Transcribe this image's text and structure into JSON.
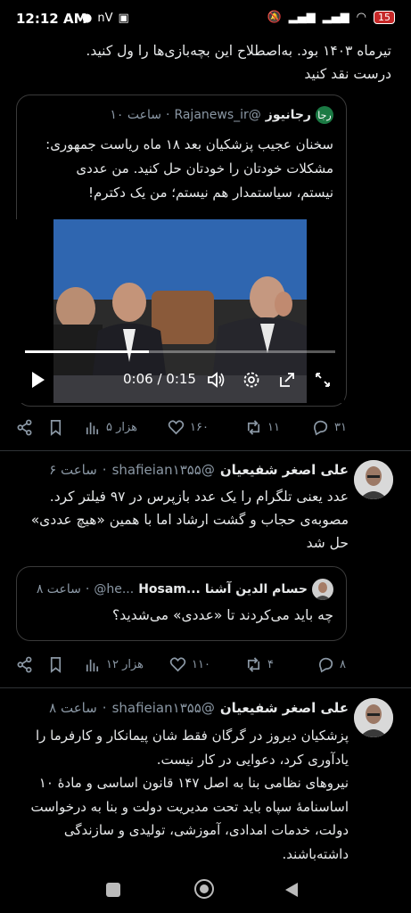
{
  "status_bar": {
    "time": "12:12 AM",
    "left_icons": [
      "chat-icon",
      "nV",
      "sim-icon"
    ],
    "right_icons": [
      "mute-icon",
      "signal-icon",
      "signal-icon",
      "wifi-icon"
    ],
    "battery": "15"
  },
  "top_text": {
    "line1": "تیرماه ۱۴۰۳ بود. به‌اصطلاح این بچه‌بازی‌ها را ول کنید.",
    "line2": "درست نقد کنید"
  },
  "quote1": {
    "logo_text": "رجا",
    "name": "رجانیوز",
    "handle": "@Rajanews_ir",
    "time": "ساعت ۱۰",
    "dot": "·",
    "text_lines": [
      "سخنان عجیب پزشکیان بعد ۱۸ ماه ریاست جمهوری:",
      "مشکلات خودتان را خودتان حل کنید. من عددی",
      "نیستم، سیاستمدار هم نیستم؛ من یک دکترم!"
    ],
    "video": {
      "time": "0:06 / 0:15",
      "progress": 0.4
    }
  },
  "actions1": {
    "replies": "۳۱",
    "retweets": "۱۱",
    "likes": "۱۶۰",
    "views": "هزار ۵"
  },
  "tweet2": {
    "name": "علی اصغر شفیعیان",
    "handle": "@shafieian۱۳۵۵",
    "time": "ساعت ۶",
    "dot": "·",
    "text_lines": [
      "عدد یعنی تلگرام را یک عدد بازپرس در ۹۷ فیلتر کرد.",
      "مصوبه‌ی حجاب و گشت ارشاد اما با همین «هیچ عددی»",
      "حل شد"
    ]
  },
  "quote2": {
    "name": "حسام الدین آشنا",
    "handle_prefix": "Hosam...",
    "handle": "@he...",
    "time": "ساعت ۸",
    "dot": "·",
    "text": "چه باید می‌کردند تا «عددی» می‌شدید؟"
  },
  "actions2": {
    "replies": "۸",
    "retweets": "۴",
    "likes": "۱۱۰",
    "views": "هزار ۱۲"
  },
  "tweet3": {
    "name": "علی اصغر شفیعیان",
    "handle": "@shafieian۱۳۵۵",
    "time": "ساعت ۸",
    "dot": "·",
    "text_lines": [
      "پزشکیان دیروز در گرگان فقط شان پیمانکار و کارفرما را",
      "یادآوری کرد، دعوایی در کار نیست.",
      "نیروهای نظامی بنا به اصل ۱۴۷ قانون اساسی و مادهٔ ۱۰",
      "اساسنامهٔ سپاه باید تحت مدیریت دولت و بنا به درخواست",
      "دولت، خدمات امدادی، آموزشی، تولیدی و سازندگی",
      "داشته‌باشند."
    ]
  },
  "nav": {
    "icons": [
      "recents-icon",
      "home-icon",
      "back-icon"
    ]
  }
}
